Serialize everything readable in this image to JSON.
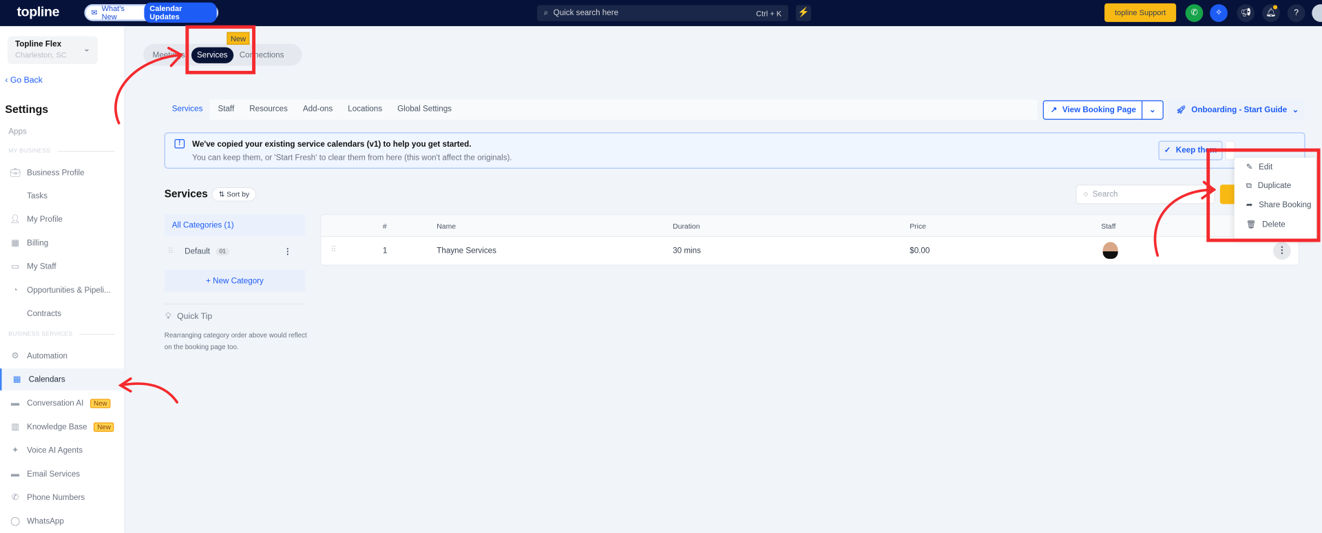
{
  "topbar": {
    "logo": "topline",
    "whats_new": "What's New",
    "calendar_updates": "Calendar Updates",
    "search_placeholder": "Quick search here",
    "shortcut": "Ctrl + K",
    "support": "topline Support"
  },
  "sidebar": {
    "location_name": "Topline Flex",
    "location_city": "Charleston, SC",
    "go_back": "Go Back",
    "title": "Settings",
    "apps": "Apps",
    "section_my_business": "MY BUSINESS",
    "section_business_services": "BUSINESS SERVICES",
    "items": [
      {
        "label": "Business Profile"
      },
      {
        "label": "Tasks"
      },
      {
        "label": "My Profile"
      },
      {
        "label": "Billing"
      },
      {
        "label": "My Staff"
      },
      {
        "label": "Opportunities & Pipeli..."
      },
      {
        "label": "Contracts"
      },
      {
        "label": "Automation"
      },
      {
        "label": "Calendars"
      },
      {
        "label": "Conversation AI",
        "badge": "New"
      },
      {
        "label": "Knowledge Base",
        "badge": "New"
      },
      {
        "label": "Voice AI Agents"
      },
      {
        "label": "Email Services"
      },
      {
        "label": "Phone Numbers"
      },
      {
        "label": "WhatsApp"
      }
    ]
  },
  "top_tabs": {
    "meetings": "Meetings",
    "services": "Services",
    "connections": "Connections",
    "new_badge": "New"
  },
  "sub_tabs": [
    "Services",
    "Staff",
    "Resources",
    "Add-ons",
    "Locations",
    "Global Settings"
  ],
  "actions": {
    "view_booking": "View Booking Page",
    "onboarding": "Onboarding - Start Guide"
  },
  "banner": {
    "title": "We've copied your existing service calendars (v1) to help you get started.",
    "text": "You can keep them, or 'Start Fresh' to clear them from here (this won't affect the originals).",
    "keep": "Keep them"
  },
  "services": {
    "heading": "Services",
    "sort": "Sort by",
    "search_placeholder": "Search"
  },
  "categories": {
    "all": "All Categories (1)",
    "default": "Default",
    "default_count": "01",
    "new": "+ New Category",
    "tip_title": "Quick Tip",
    "tip_text": "Rearranging category order above would reflect on the booking page too."
  },
  "table": {
    "headers": [
      "#",
      "Name",
      "Duration",
      "Price",
      "Staff"
    ],
    "rows": [
      {
        "num": "1",
        "name": "Thayne Services",
        "duration": "30 mins",
        "price": "$0.00"
      }
    ]
  },
  "menu": [
    "Edit",
    "Duplicate",
    "Share Booking",
    "Delete"
  ],
  "colors": {
    "accent": "#1d5cf5",
    "annotation": "#f42a2e",
    "topbar": "#06123a"
  }
}
